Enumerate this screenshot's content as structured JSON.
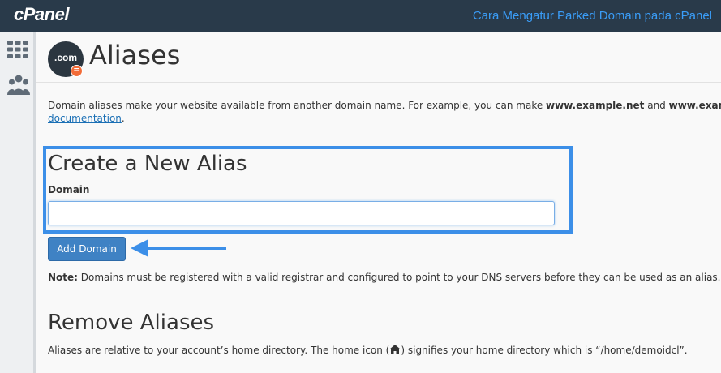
{
  "header": {
    "logo": "cPanel",
    "title": "Cara Mengatur Parked Domain pada cPanel"
  },
  "sidebar": {
    "items": [
      {
        "icon": "grid-icon"
      },
      {
        "icon": "users-icon"
      }
    ]
  },
  "page": {
    "icon_text": ".com",
    "icon_badge": "=",
    "title": "Aliases"
  },
  "description": {
    "part1": "Domain aliases make your website available from another domain name. For example, you can make ",
    "bold1": "www.example.net",
    "part2": " and ",
    "bold2": "www.example.",
    "link": "documentation",
    "part3": "."
  },
  "create": {
    "heading": "Create a New Alias",
    "domain_label": "Domain",
    "domain_value": "",
    "domain_placeholder": "",
    "button_label": "Add Domain"
  },
  "note": {
    "label": "Note:",
    "text": " Domains must be registered with a valid registrar and configured to point to your DNS servers before they can be used as an alias."
  },
  "remove": {
    "heading": "Remove Aliases",
    "text1": "Aliases are relative to your account’s home directory. The home icon (",
    "text2": ") signifies your home directory which is “/home/demoidcl”."
  },
  "colors": {
    "topbar": "#293a4a",
    "accent": "#3c8fe8",
    "button": "#3f82c4",
    "badge": "#f26c38"
  }
}
